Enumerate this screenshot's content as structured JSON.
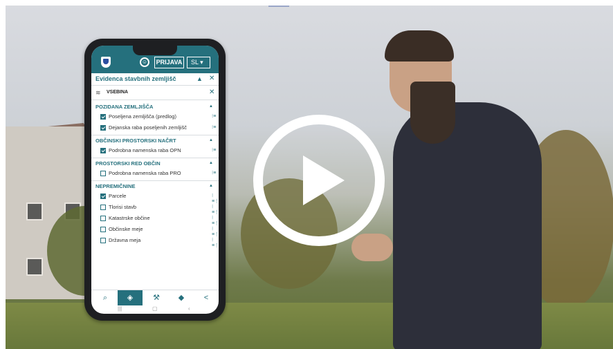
{
  "app": {
    "login_label": "PRIJAVA",
    "language_label": "SL ▾",
    "accessibility_icon": "accessibility-icon",
    "crest_icon": "slovenia-crest-icon"
  },
  "panel": {
    "title": "Evidenca stavbnih zemljišč",
    "content_label": "VSEBINA"
  },
  "sections": [
    {
      "title": "POZIDANA ZEMLJIŠČA",
      "items": [
        {
          "label": "Poseljena zemljišča (predlog)",
          "checked": true
        },
        {
          "label": "Dejanska raba poseljenih zemljišč",
          "checked": true
        }
      ]
    },
    {
      "title": "OBČINSKI PROSTORSKI NAČRT",
      "items": [
        {
          "label": "Podrobna namenska raba OPN",
          "checked": true
        }
      ]
    },
    {
      "title": "PROSTORSKI RED OBČIN",
      "items": [
        {
          "label": "Podrobna namenska raba PRO",
          "checked": false
        }
      ]
    },
    {
      "title": "NEPREMIČNINE",
      "items": [
        {
          "label": "Parcele",
          "checked": true
        },
        {
          "label": "Tlorisi stavb",
          "checked": false
        },
        {
          "label": "Katastrske občine",
          "checked": false
        },
        {
          "label": "Občinske meje",
          "checked": false
        },
        {
          "label": "Državna meja",
          "checked": false
        }
      ]
    }
  ],
  "bottom_nav": [
    "search-icon",
    "layers-icon",
    "tools-icon",
    "stack-icon",
    "share-icon"
  ],
  "video": {
    "play_icon": "play-icon"
  },
  "colors": {
    "accent": "#25707d",
    "background": "#ffffff"
  }
}
